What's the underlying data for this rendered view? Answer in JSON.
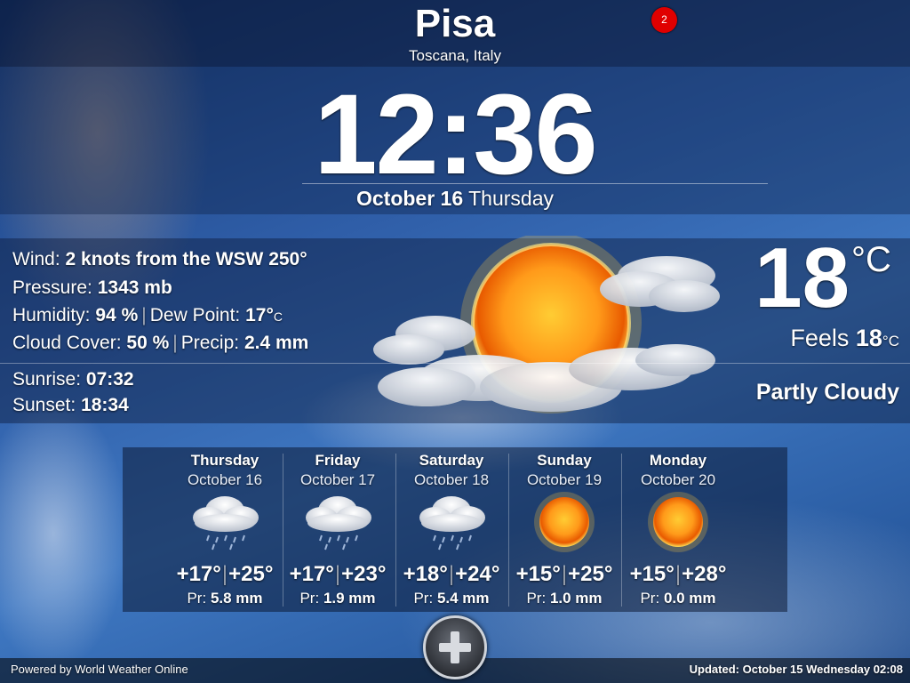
{
  "location": {
    "city": "Pisa",
    "region": "Toscana, Italy"
  },
  "notification": {
    "count": "2"
  },
  "clock": {
    "time": "12:36",
    "date_bold": "October 16",
    "weekday": "Thursday"
  },
  "details": {
    "wind_label": "Wind:",
    "wind_value": "2 knots from the WSW 250°",
    "pressure_label": "Pressure:",
    "pressure_value": "1343 mb",
    "humidity_label": "Humidity:",
    "humidity_value": "94 %",
    "dew_label": "Dew Point:",
    "dew_value": "17°",
    "dew_unit": "C",
    "cloud_label": "Cloud Cover:",
    "cloud_value": "50 %",
    "precip_label": "Precip:",
    "precip_value": "2.4 mm",
    "sunrise_label": "Sunrise:",
    "sunrise_value": "07:32",
    "sunset_label": "Sunset:",
    "sunset_value": "18:34"
  },
  "current": {
    "temp": "18",
    "unit": "°C",
    "feels_label": "Feels",
    "feels_value": "18",
    "feels_unit": "°C",
    "condition": "Partly Cloudy",
    "icon": "sun-cloud-icon"
  },
  "forecast": [
    {
      "day": "Thursday",
      "date": "October 16",
      "low": "+17°",
      "high": "+25°",
      "pr_label": "Pr:",
      "pr": "5.8 mm",
      "icon": "rain-cloud-icon"
    },
    {
      "day": "Friday",
      "date": "October 17",
      "low": "+17°",
      "high": "+23°",
      "pr_label": "Pr:",
      "pr": "1.9 mm",
      "icon": "rain-cloud-icon"
    },
    {
      "day": "Saturday",
      "date": "October 18",
      "low": "+18°",
      "high": "+24°",
      "pr_label": "Pr:",
      "pr": "5.4 mm",
      "icon": "rain-cloud-icon"
    },
    {
      "day": "Sunday",
      "date": "October 19",
      "low": "+15°",
      "high": "+25°",
      "pr_label": "Pr:",
      "pr": "1.0 mm",
      "icon": "sun-icon"
    },
    {
      "day": "Monday",
      "date": "October 20",
      "low": "+15°",
      "high": "+28°",
      "pr_label": "Pr:",
      "pr": "0.0 mm",
      "icon": "sun-icon"
    }
  ],
  "footer": {
    "powered": "Powered by World Weather Online",
    "updated": "Updated: October 15 Wednesday 02:08",
    "add_icon": "plus-icon"
  }
}
